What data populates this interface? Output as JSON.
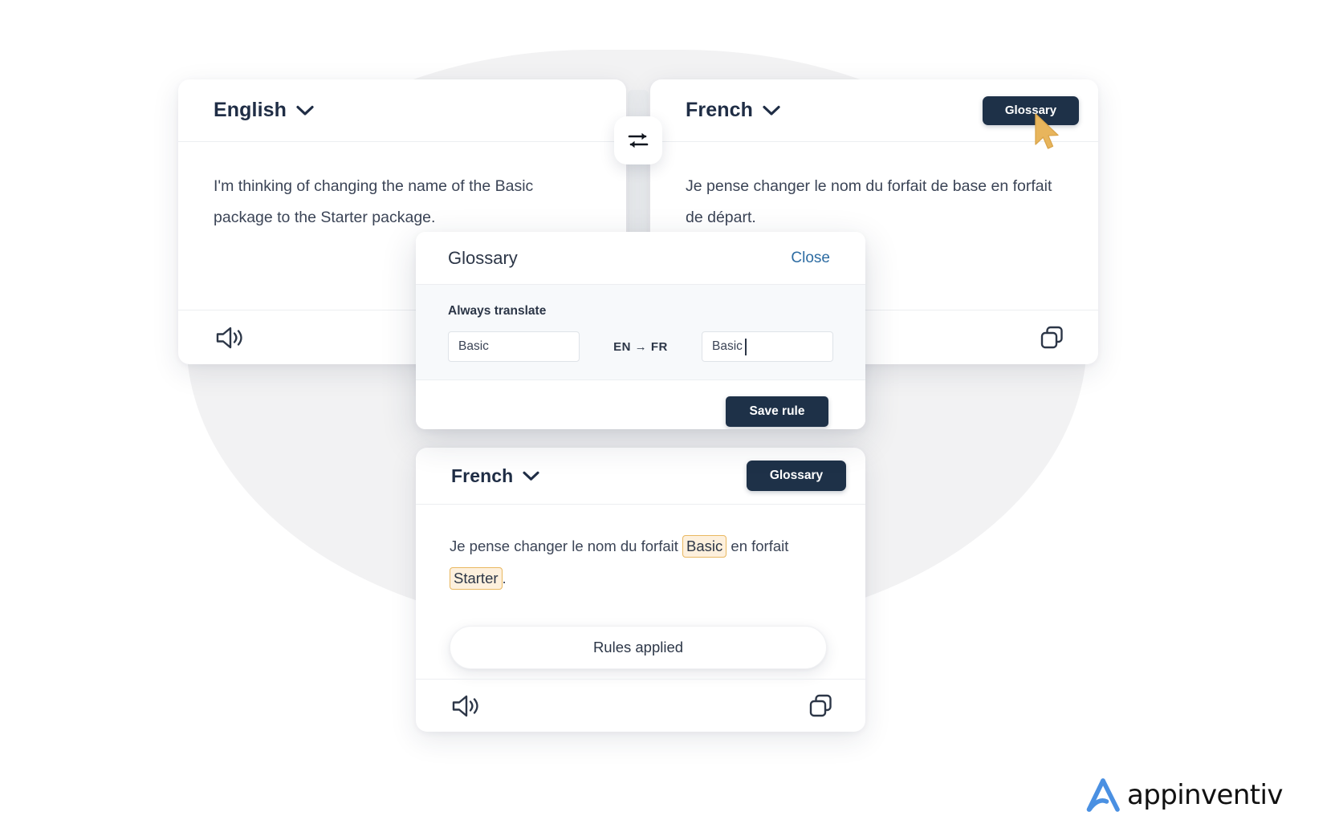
{
  "source_panel": {
    "language": "English",
    "text": "I'm thinking of changing the name of the Basic package to the Starter package.",
    "speak_icon": "speaker-icon"
  },
  "target_panel_top": {
    "language": "French",
    "text": "Je pense changer le nom du forfait de base en forfait de départ.",
    "glossary_label": "Glossary",
    "copy_icon": "copy-icon"
  },
  "swap_button": {
    "icon": "swap-arrows-icon"
  },
  "glossary_modal": {
    "title": "Glossary",
    "close_label": "Close",
    "section_label": "Always translate",
    "source_term_value": "Basic",
    "source_term_placeholder": "Basic",
    "direction": "EN → FR",
    "direction_from": "EN",
    "direction_to": "FR",
    "target_term_value": "Basic",
    "target_term_placeholder": "Basic",
    "save_label": "Save rule"
  },
  "target_panel_bottom": {
    "language": "French",
    "glossary_label": "Glossary",
    "text_part_1": "Je pense changer le nom du forfait ",
    "highlight_1": "Basic",
    "text_part_2": " en forfait ",
    "highlight_2": "Starter",
    "text_part_3": ".",
    "rules_applied_label": "Rules applied",
    "speak_icon": "speaker-icon",
    "copy_icon": "copy-icon"
  },
  "brand": {
    "name": "appinventiv",
    "mark_color": "#4a90e2",
    "text_color": "#111111"
  },
  "theme": {
    "dark_navy": "#1e3148",
    "link_blue": "#2d6ca2",
    "highlight_bg": "#fdf0dd",
    "highlight_border": "#e9b861",
    "cursor_gold": "#e8b55c",
    "background_blob": "#f2f2f3"
  }
}
